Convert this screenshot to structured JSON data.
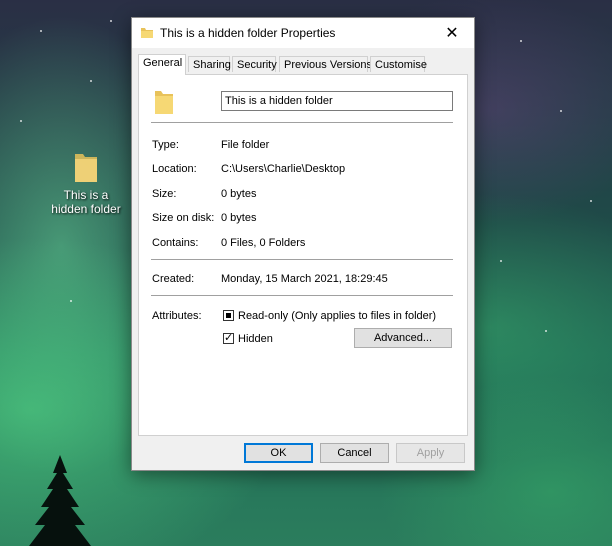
{
  "desktop": {
    "icon_label": "This is a hidden folder"
  },
  "dialog": {
    "title": "This is a hidden folder Properties",
    "tabs": [
      "General",
      "Sharing",
      "Security",
      "Previous Versions",
      "Customise"
    ],
    "name_value": "This is a hidden folder",
    "fields": [
      {
        "label": "Type:",
        "value": "File folder"
      },
      {
        "label": "Location:",
        "value": "C:\\Users\\Charlie\\Desktop"
      },
      {
        "label": "Size:",
        "value": "0 bytes"
      },
      {
        "label": "Size on disk:",
        "value": "0 bytes"
      },
      {
        "label": "Contains:",
        "value": "0 Files, 0 Folders"
      }
    ],
    "created": {
      "label": "Created:",
      "value": "Monday, 15 March 2021, 18:29:45"
    },
    "attributes": {
      "label": "Attributes:",
      "read_only": {
        "text": "Read-only (Only applies to files in folder)",
        "state": "indeterminate"
      },
      "hidden": {
        "text": "Hidden",
        "state": "checked"
      },
      "advanced_label": "Advanced..."
    },
    "buttons": {
      "ok": "OK",
      "cancel": "Cancel",
      "apply": "Apply"
    }
  },
  "colors": {
    "folder": "#e8c25a",
    "accent": "#0078d7"
  },
  "icons": [
    "folder-icon",
    "close-icon",
    "checkmark-icon"
  ]
}
